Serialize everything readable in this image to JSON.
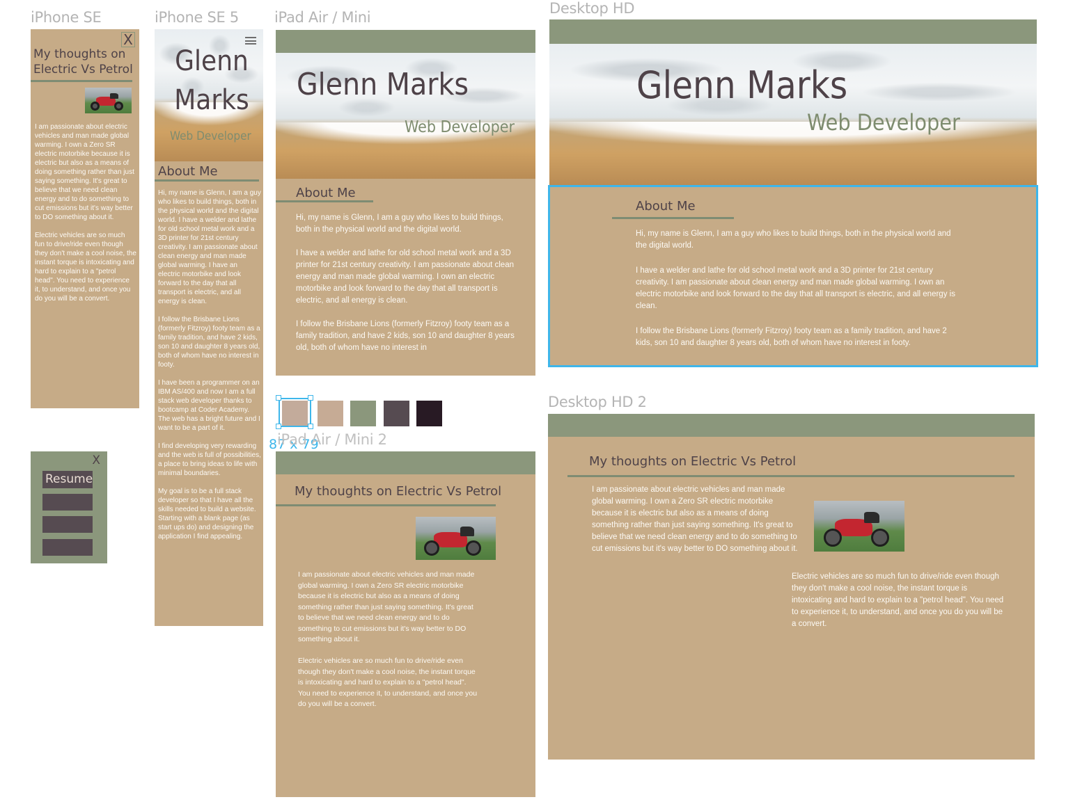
{
  "frames": {
    "iphone_se": {
      "label": "iPhone SE",
      "close": "X",
      "title": "My thoughts on Electric Vs Petrol",
      "paragraphs": [
        "I am passionate about electric vehicles and man made global warming. I own a Zero SR electric motorbike because it is electric but also as a means of doing something rather than just saying something. It's great to believe that we need clean energy and to do something to cut emissions but it's way better to DO something about it.",
        "Electric vehicles are so much fun to drive/ride even though they don't make a cool noise, the instant torque is intoxicating and hard to explain to a \"petrol head\". You need to experience it, to understand, and once you do you will be a convert."
      ]
    },
    "iphone_se_menu": {
      "close": "X",
      "items": [
        "Resume",
        "",
        "",
        ""
      ]
    },
    "iphone_se5": {
      "label": "iPhone SE 5",
      "name": "Glenn Marks",
      "role": "Web Developer",
      "section_title": "About Me",
      "paragraphs": [
        "Hi, my name is Glenn, I am a guy who likes to build things, both in the physical world and the digital world. I have a welder and lathe for old school metal work and a 3D printer for 21st century creativity. I am passionate about clean energy and man made global warming. I have an electric motorbike and look forward to the day that all transport is electric, and all energy is clean.",
        "I follow the Brisbane Lions (formerly Fitzroy) footy team as a family tradition, and have 2 kids, son 10 and daughter 8 years old, both of whom have no interest in footy.",
        "I have been a programmer on an IBM AS/400 and now I am a full stack web developer thanks to bootcamp at Coder Academy. The web has a bright future and I want to be a part of it.",
        "I find developing very rewarding and the web is full of possibilities, a place to bring ideas to life with minimal boundaries.",
        "My goal is to be a full stack developer so that I have all the skills needed to build a website. Starting with a blank page (as start ups do) and designing the application I find appealing."
      ]
    },
    "ipad": {
      "label": "iPad Air / Mini",
      "name": "Glenn Marks",
      "role": "Web Developer",
      "section_title": "About Me",
      "paragraphs": [
        "Hi, my name is Glenn, I am a guy who likes to build things, both in the physical world and the digital world.",
        "I have a welder and lathe for old school metal work and a 3D printer for 21st century creativity. I am passionate about clean energy and man made global warming. I own an electric motorbike and look forward to the day that all transport is electric, and all energy is clean.",
        "I follow the Brisbane Lions (formerly Fitzroy) footy team as a family tradition, and have 2 kids, son 10 and daughter 8 years old, both of whom have no interest in"
      ]
    },
    "ipad2": {
      "label": "iPad Air / Mini 2",
      "title": "My thoughts on Electric Vs Petrol",
      "paragraphs": [
        "I am passionate about electric vehicles and man made global warming. I own a Zero SR electric motorbike because it is electric but also as a means of doing something rather than just saying something. It's great to believe that we need clean energy and to do something to cut emissions but it's way better to DO something about it.",
        "Electric vehicles are so much fun to drive/ride even though they don't make a cool noise, the instant torque is intoxicating and hard to explain to a \"petrol head\". You need to experience it, to understand, and once you do you will be a convert."
      ]
    },
    "desktop": {
      "label": "Desktop HD",
      "name": "Glenn Marks",
      "role": "Web Developer",
      "section_title": "About Me",
      "paragraphs": [
        "Hi, my name is Glenn, I am a guy who likes to build things, both in the physical world and the digital world.",
        "I have a welder and lathe for old school metal work and a 3D printer for 21st century creativity. I am passionate about clean energy and man made global warming. I own an electric motorbike and look forward to the day that all transport is electric, and all energy is clean.",
        "I follow the Brisbane Lions (formerly Fitzroy) footy team as a family tradition, and have 2 kids, son 10 and daughter 8 years old, both of whom have no interest in footy."
      ]
    },
    "desktop2": {
      "label": "Desktop HD 2",
      "title": "My thoughts on Electric Vs Petrol",
      "paragraphs": [
        "I am passionate about electric vehicles and man made global warming. I own a Zero SR electric motorbike because it is electric but also as a means of doing something rather than just saying something. It's great to believe that we need clean energy and to do something to cut emissions but it's way better to DO something about it.",
        "Electric vehicles are so much fun to drive/ride even though they don't make a cool noise, the instant torque is intoxicating and hard to explain to a \"petrol head\". You need to experience it, to understand, and once you do you will be a convert."
      ]
    }
  },
  "palette": {
    "swatches": [
      "#c3ab9b",
      "#c6ab95",
      "#8b977c",
      "#564b51",
      "#281a24"
    ],
    "selection_size": "87 x 79"
  },
  "colors": {
    "sand": "#c6ab87",
    "sage": "#8b977c",
    "plum": "#4e4248",
    "selection": "#3eb6ea"
  }
}
